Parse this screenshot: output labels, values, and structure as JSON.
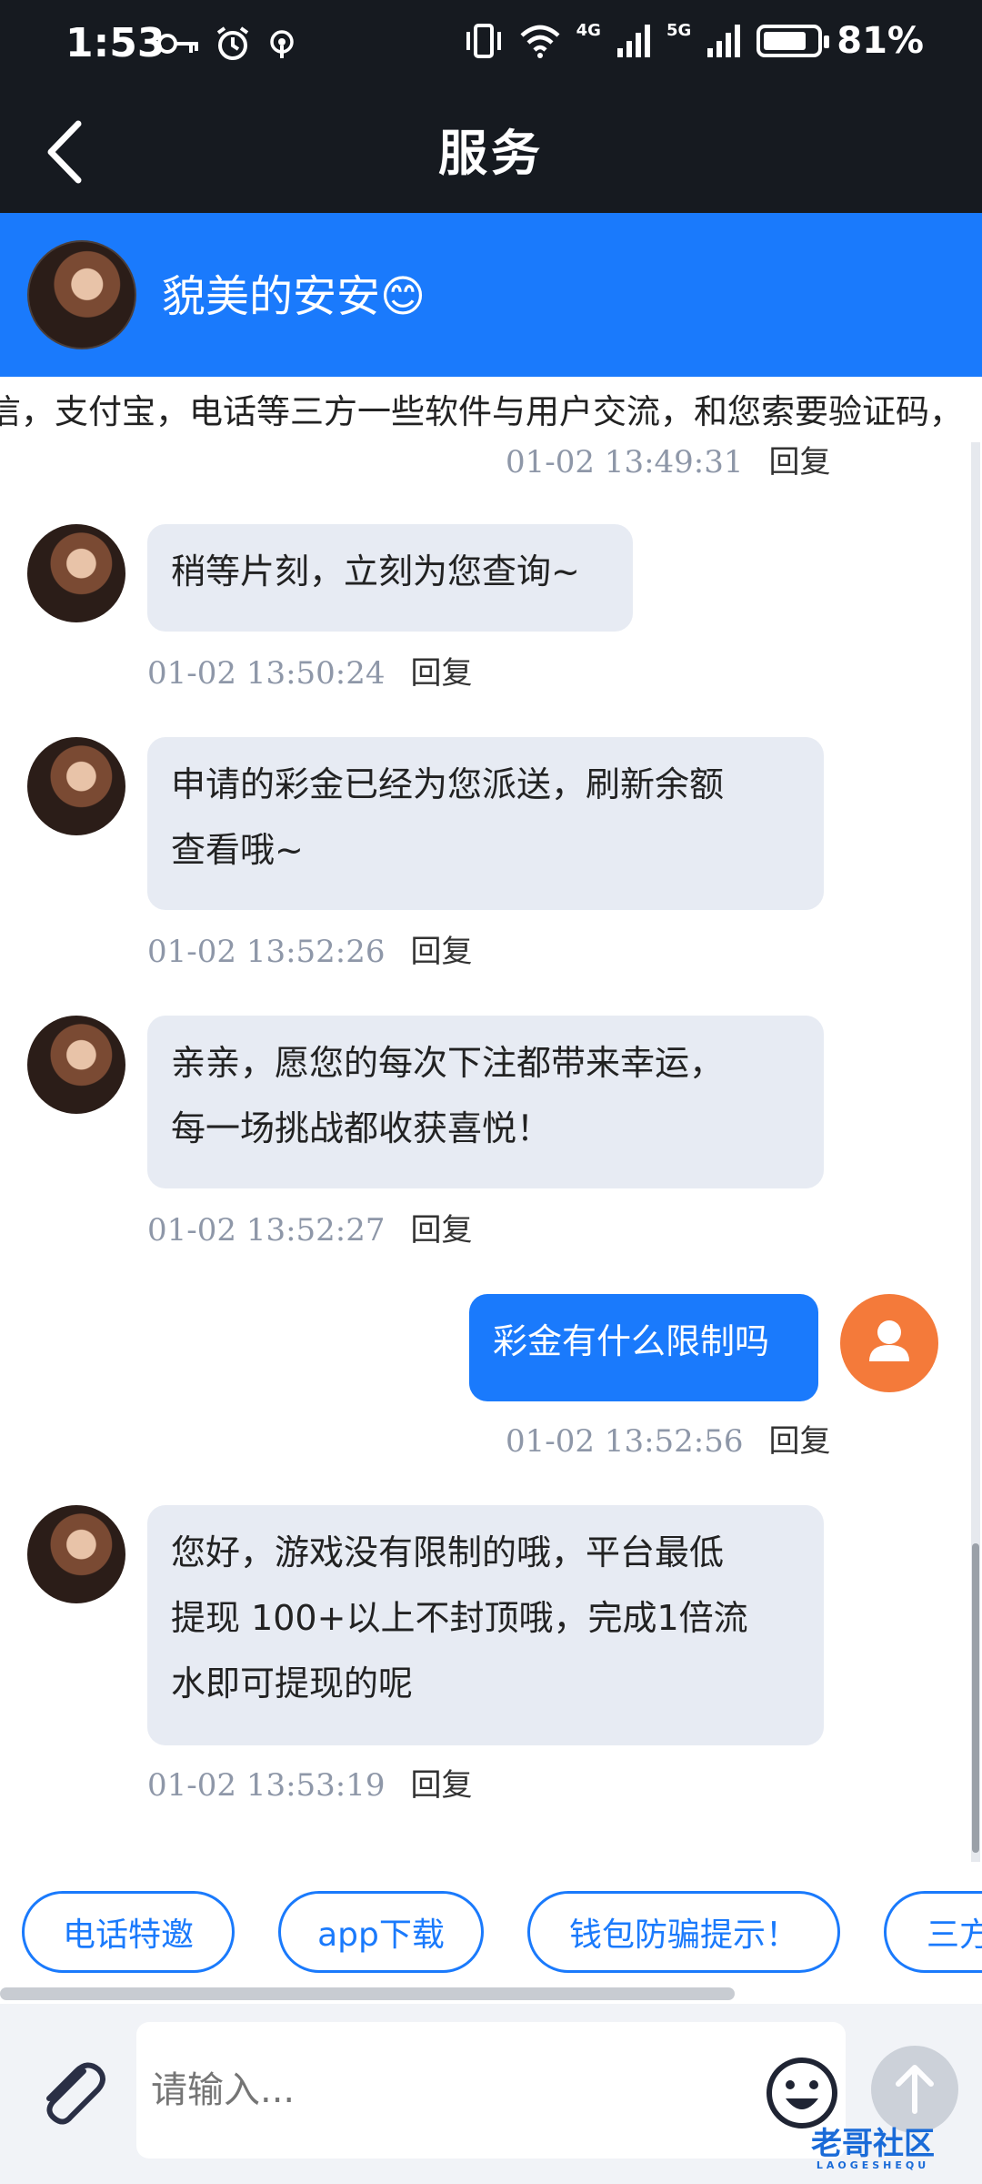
{
  "status_bar": {
    "time": "1:53",
    "network_4g": "4G",
    "network_5g": "5G",
    "battery": "81%",
    "battery_level": 0.81
  },
  "nav": {
    "title": "服务"
  },
  "agent": {
    "name": "貌美的安安😊"
  },
  "notice": {
    "text": "信，支付宝，电话等三方一些软件与用户交流，和您索要验证码，"
  },
  "messages": [
    {
      "from": "user",
      "time": "01-02 13:49:31",
      "reply": "回复"
    },
    {
      "from": "agent",
      "text": "稍等片刻，立刻为您查询~",
      "time": "01-02 13:50:24",
      "reply": "回复"
    },
    {
      "from": "agent",
      "lines": [
        "申请的彩金已经为您派送，刷新余额",
        "查看哦~"
      ],
      "time": "01-02 13:52:26",
      "reply": "回复"
    },
    {
      "from": "agent",
      "lines": [
        "亲亲，愿您的每次下注都带来幸运，",
        "每一场挑战都收获喜悦！"
      ],
      "time": "01-02 13:52:27",
      "reply": "回复"
    },
    {
      "from": "user",
      "text": "彩金有什么限制吗",
      "time": "01-02 13:52:56",
      "reply": "回复"
    },
    {
      "from": "agent",
      "lines": [
        "您好，游戏没有限制的哦，平台最低",
        "提现 100+以上不封顶哦，完成1倍流",
        "水即可提现的呢"
      ],
      "time": "01-02 13:53:19",
      "reply": "回复"
    }
  ],
  "quick_replies": [
    "电话特邀",
    "app下载",
    "钱包防骗提示！",
    "三方"
  ],
  "input": {
    "placeholder": "请输入..."
  },
  "watermark": {
    "text": "老哥社区",
    "sub": "LAOGESHEQU"
  },
  "colors": {
    "brand_blue": "#1a7afc",
    "dark_bar": "#161a20",
    "agent_bubble": "#e7ebf3",
    "user_avatar": "#f47a3a"
  }
}
